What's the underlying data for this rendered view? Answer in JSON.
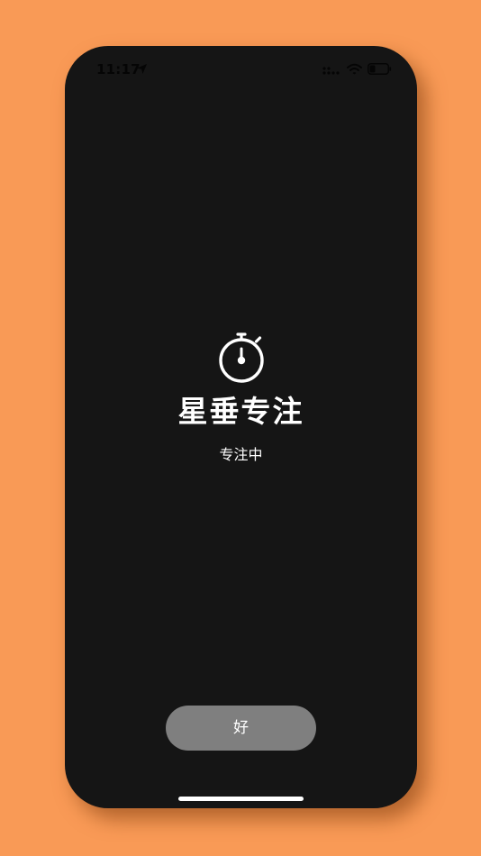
{
  "status_bar": {
    "time": "11:17",
    "location_icon": "location-arrow-icon",
    "signal_icon": "cellular-signal-icon",
    "wifi_icon": "wifi-icon",
    "battery_icon": "battery-icon"
  },
  "focus_screen": {
    "icon": "stopwatch-icon",
    "title": "星垂专注",
    "status": "专注中"
  },
  "ok_button": {
    "label": "好"
  },
  "colors": {
    "background": "#F99A56",
    "screen": "#151515",
    "button": "#7F7F7F",
    "text": "#FFFFFF"
  }
}
